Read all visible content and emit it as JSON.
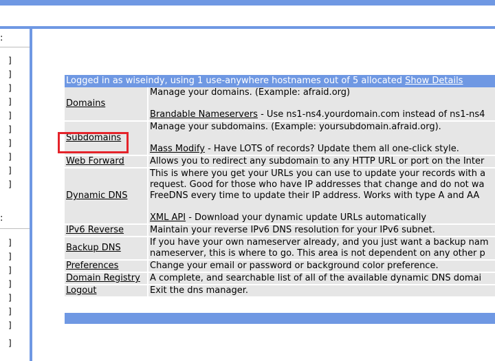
{
  "sidebar": {
    "section1_heading": ":",
    "section1_items": [
      "]",
      "]",
      "]",
      "]",
      "]",
      "]",
      "]",
      "]",
      "]",
      "]"
    ],
    "section2_heading": ":",
    "section2_items": [
      "]",
      "]",
      "]",
      "]",
      "]",
      "]",
      "]",
      "]"
    ]
  },
  "header": {
    "status_text": "Logged in as wiseindy, using 1 use-anywhere hostnames out of 5 allocated",
    "show_details_label": "Show Details"
  },
  "rows": [
    {
      "link": "Domains",
      "lines": [
        "Manage your domains. (Example: afraid.org)",
        ""
      ],
      "sublink": "Brandable Nameservers",
      "subtext": " - Use ns1-ns4.yourdomain.com instead of ns1-ns4"
    },
    {
      "link": "Subdomains",
      "lines": [
        "Manage your subdomains. (Example: yoursubdomain.afraid.org).",
        ""
      ],
      "sublink": "Mass Modify",
      "subtext": " - Have LOTS of records? Update them all one-click style."
    },
    {
      "link": "Web Forward",
      "lines": [
        "Allows you to redirect any subdomain to any HTTP URL or port on the Inter"
      ]
    },
    {
      "link": "Dynamic DNS",
      "lines": [
        "This is where you get your URLs you can use to update your records with a",
        "request. Good for those who have IP addresses that change and do not wa",
        "FreeDNS every time to update their IP address. Works with type A and AA",
        ""
      ],
      "sublink": "XML API",
      "subtext": " - Download your dynamic update URLs automatically"
    },
    {
      "link": "IPv6 Reverse",
      "lines": [
        "Maintain your reverse IPv6 DNS resolution for your IPv6 subnet."
      ]
    },
    {
      "link": "Backup DNS",
      "lines": [
        "If you have your own nameserver already, and you just want a backup nam",
        "nameserver, this is where to go. This area is not dependent on any other p"
      ]
    },
    {
      "link": "Preferences",
      "lines": [
        "Change your email or password or background color preference."
      ]
    },
    {
      "link": "Domain Registry",
      "lines": [
        "A complete, and searchable list of all of the available dynamic DNS domai"
      ]
    },
    {
      "link": "Logout",
      "lines": [
        "Exit the dns manager."
      ]
    }
  ],
  "colors": {
    "accent": "#6f98e3",
    "cell_bg": "#e6e6e6",
    "highlight": "#e4232a"
  }
}
